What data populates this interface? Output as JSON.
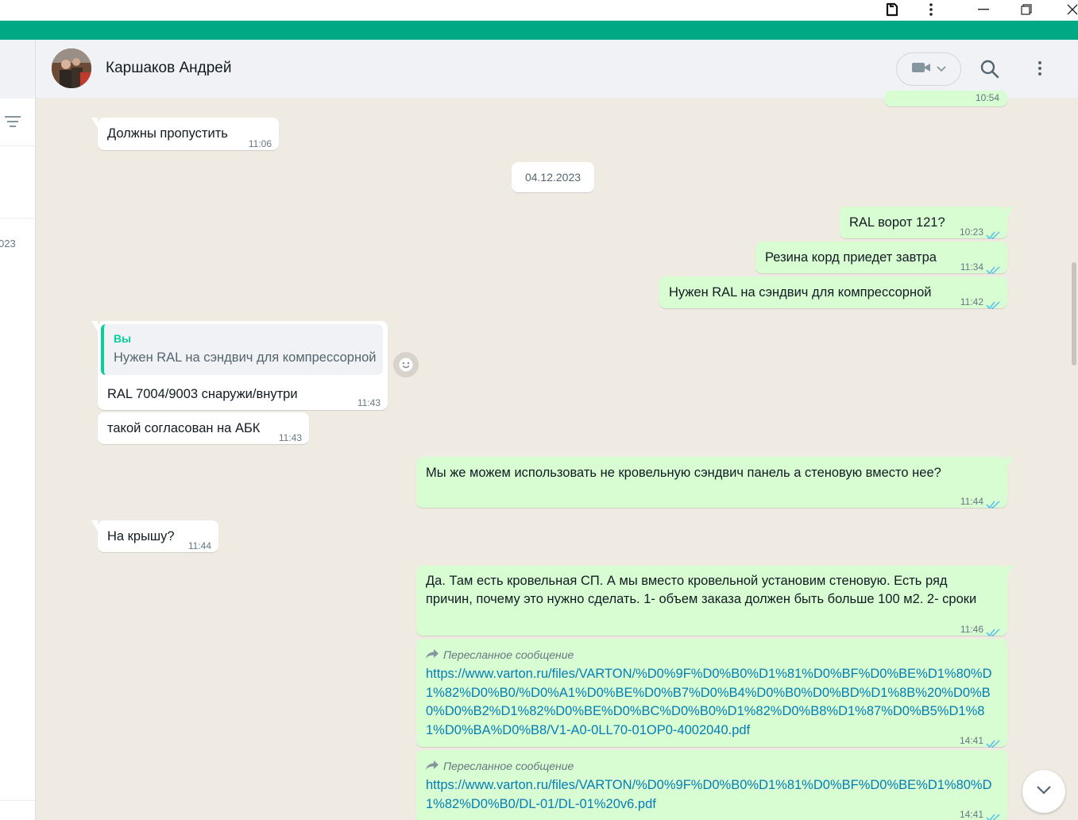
{
  "contact": {
    "name": "Каршаков Андрей"
  },
  "left_panel": {
    "partial_date": "023"
  },
  "date_separator": "04.12.2023",
  "messages": [
    {
      "text": "Должны пропустить",
      "time": "11:06"
    },
    {
      "text": "RAL ворот 121?",
      "time": "10:23"
    },
    {
      "text": "Резина корд приедет завтра",
      "time": "11:34"
    },
    {
      "text": "Нужен RAL на сэндвич для компрессорной",
      "time": "11:42"
    },
    {
      "quote_author": "Вы",
      "quote_text": "Нужен RAL на сэндвич для компрессорной",
      "text": "RAL 7004/9003 снаружи/внутри",
      "time": "11:43"
    },
    {
      "text": "такой согласован на АБК",
      "time": "11:43"
    },
    {
      "text": "Мы же можем использовать не кровельную сэндвич панель а стеновую вместо нее?",
      "time": "11:44"
    },
    {
      "text": "На крышу?",
      "time": "11:44"
    },
    {
      "text": "Да. Там есть кровельная СП. А мы вместо кровельной установим стеновую. Есть ряд причин, почему это нужно сделать. 1- объем заказа должен быть больше 100 м2. 2- сроки",
      "time": "11:46"
    },
    {
      "forwarded_label": "Пересланное сообщение",
      "link": "https://www.varton.ru/files/VARTON/%D0%9F%D0%B0%D1%81%D0%BF%D0%BE%D1%80%D1%82%D0%B0/%D0%A1%D0%BE%D0%B7%D0%B4%D0%B0%D0%BD%D1%8B%20%D0%B0%D0%B2%D1%82%D0%BE%D0%BC%D0%B0%D1%82%D0%B8%D1%87%D0%B5%D1%81%D0%BA%D0%B8/V1-A0-0LL70-01OP0-4002040.pdf",
      "time": "14:41"
    },
    {
      "forwarded_label": "Пересланное сообщение",
      "link": "https://www.varton.ru/files/VARTON/%D0%9F%D0%B0%D1%81%D0%BF%D0%BE%D1%80%D1%82%D0%B0/DL-01/DL-01%20v6.pdf",
      "time": "14:41"
    }
  ],
  "partial_top_time": "10:54",
  "colors": {
    "accent": "#00a884",
    "outgoing": "#d9fdd3",
    "incoming": "#ffffff",
    "background": "#efeae2",
    "link": "#027eb5",
    "read_ticks": "#53bdeb"
  }
}
